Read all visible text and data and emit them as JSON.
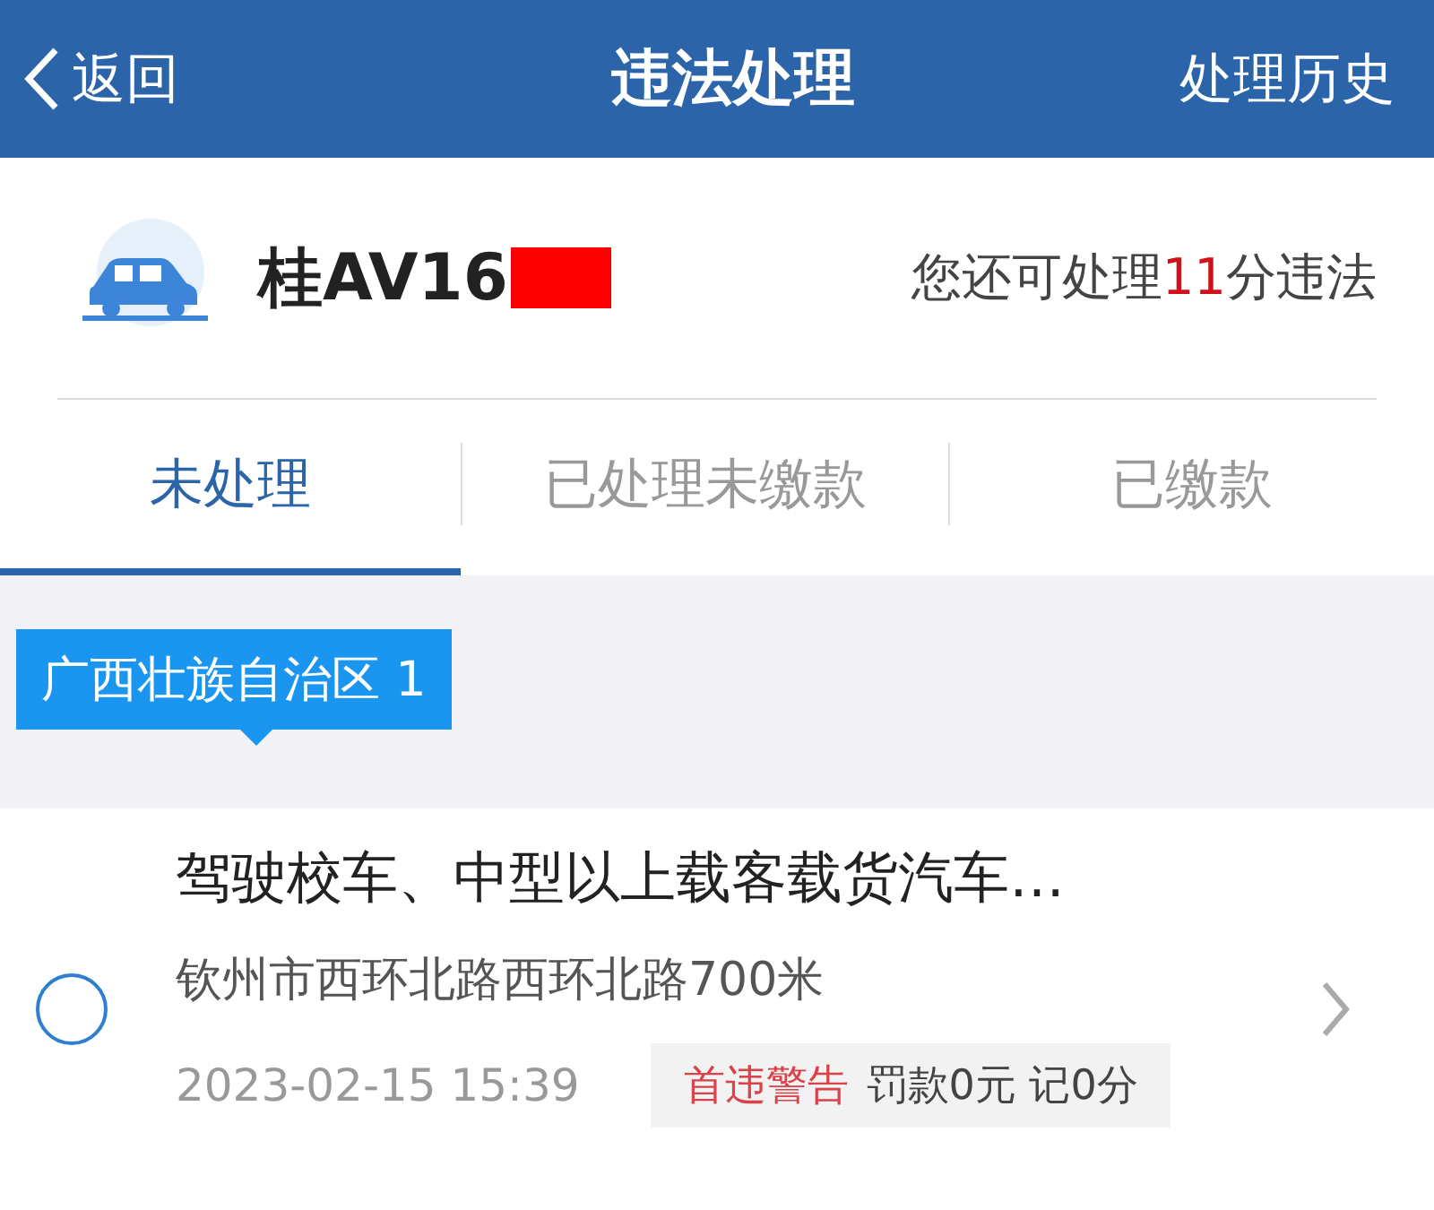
{
  "header": {
    "back": "返回",
    "title": "违法处理",
    "action": "处理历史"
  },
  "vehicle": {
    "plate": "桂AV16",
    "quota_prefix": "您还可处理",
    "quota_points": "11",
    "quota_suffix": "分违法"
  },
  "tabs": [
    {
      "label": "未处理",
      "selected": true
    },
    {
      "label": "已处理未缴款",
      "selected": false
    },
    {
      "label": "已缴款",
      "selected": false
    }
  ],
  "region": {
    "label": "广西壮族自治区 1"
  },
  "violations": [
    {
      "title": "驾驶校车、中型以上载客载货汽车…",
      "location": "钦州市西环北路西环北路700米",
      "time": "2023-02-15 15:39",
      "tag": "首违警告",
      "penalty": "罚款0元 记0分",
      "checked": false
    }
  ]
}
